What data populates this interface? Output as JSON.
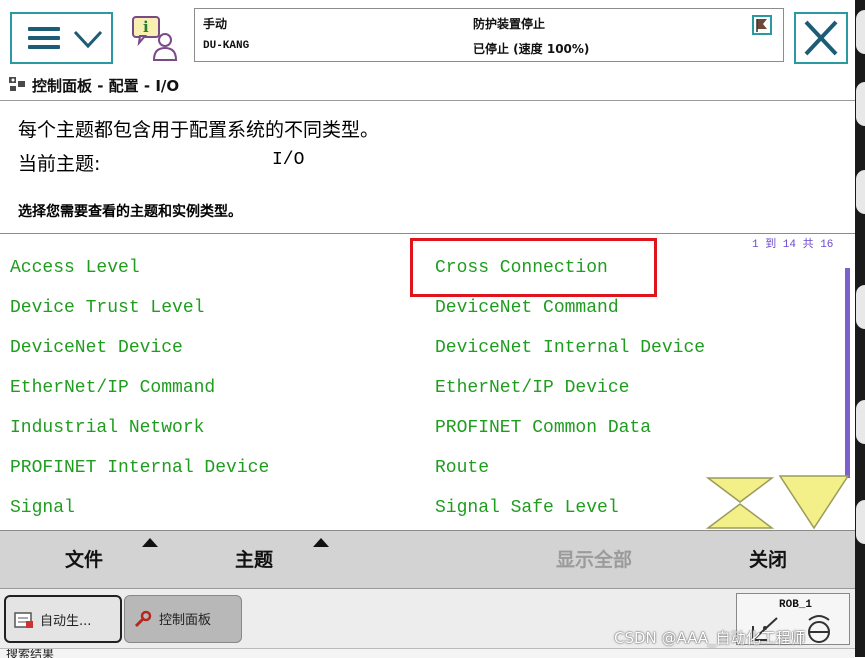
{
  "topbar": {
    "mode_label": "手动",
    "controller_name": "DU-KANG",
    "safety_status": "防护装置停止",
    "run_status": "已停止 (速度 100%)",
    "icons": {
      "menu": "hamburger-menu-icon",
      "info": "event-info-icon",
      "flag": "status-flag-icon",
      "close": "close-icon"
    }
  },
  "breadcrumb": {
    "text": "控制面板 - 配置 - I/O",
    "icon": "control-panel-icon"
  },
  "info": {
    "description": "每个主题都包含用于配置系统的不同类型。",
    "current_topic_label": "当前主题:",
    "current_topic_value": "I/O",
    "hint": "选择您需要查看的主题和实例类型。"
  },
  "list": {
    "pager": "1 到 14 共 16",
    "items": [
      "Access Level",
      "Cross Connection",
      "Device Trust Level",
      "DeviceNet Command",
      "DeviceNet Device",
      "DeviceNet Internal Device",
      "EtherNet/IP Command",
      "EtherNet/IP Device",
      "Industrial Network",
      "PROFINET Common Data",
      "PROFINET Internal Device",
      "Route",
      "Signal",
      "Signal Safe Level"
    ],
    "highlighted_item": "Cross Connection",
    "highlight_color": "#e0141c",
    "item_color": "#1f9d1f"
  },
  "commands": {
    "file": "文件",
    "topic": "主题",
    "show_all": "显示全部",
    "close": "关闭"
  },
  "taskbar": {
    "auto_label": "自动生...",
    "control_panel_label": "控制面板",
    "rob_label": "ROB_1"
  },
  "bottom": {
    "text": "搜索结果"
  },
  "watermark": "CSDN @AAA_自动化工程师"
}
